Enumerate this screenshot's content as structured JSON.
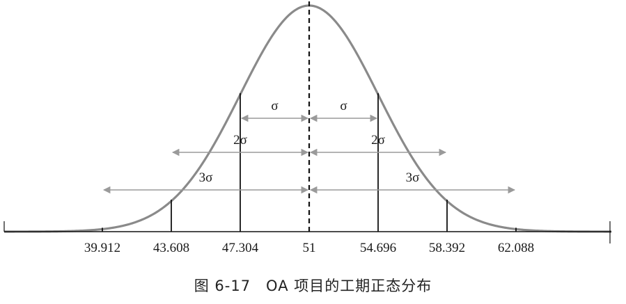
{
  "figure": {
    "caption": "图 6-17　OA 项目的工期正态分布",
    "mean": 51,
    "sigma": 3.696,
    "tick_values": [
      39.912,
      43.608,
      47.304,
      51,
      54.696,
      58.392,
      62.088
    ],
    "tick_labels": [
      "39.912",
      "43.608",
      "47.304",
      "51",
      "54.696",
      "58.392",
      "62.088"
    ],
    "sigma_intervals": [
      {
        "label": "σ",
        "from": 47.304,
        "to": 51
      },
      {
        "label": "σ",
        "from": 51,
        "to": 54.696
      },
      {
        "label": "2σ",
        "from": 43.608,
        "to": 51
      },
      {
        "label": "2σ",
        "from": 51,
        "to": 58.392
      },
      {
        "label": "3σ",
        "from": 39.912,
        "to": 51
      },
      {
        "label": "3σ",
        "from": 51,
        "to": 62.088
      }
    ],
    "colors": {
      "curve": "#8a8a8a",
      "lines": "#111111",
      "arrows": "#9a9a9a"
    }
  }
}
